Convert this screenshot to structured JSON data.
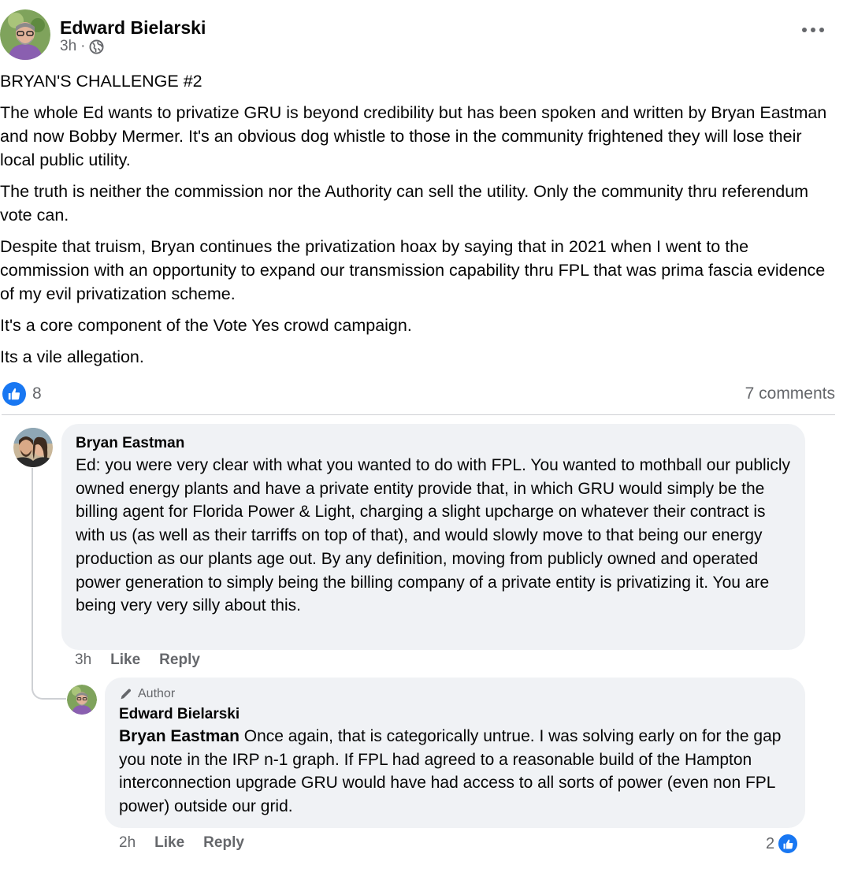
{
  "post": {
    "author": "Edward Bielarski",
    "time": "3h",
    "separator": "·",
    "privacy_icon": "globe-icon",
    "more_icon": "more-options-icon",
    "paragraphs": [
      "BRYAN'S CHALLENGE #2",
      "The whole Ed wants to privatize GRU is beyond credibility but has been spoken and written by Bryan Eastman and now Bobby Mermer.  It's an obvious dog whistle to those in the community frightened they will lose their local public utility.",
      "The truth is neither the commission nor the Authority can sell the utility.  Only the community thru referendum vote can.",
      "Despite that truism, Bryan continues the privatization hoax by saying that in 2021 when I went to the commission with an opportunity to expand our transmission capability thru FPL that was prima fascia evidence of my evil privatization scheme.",
      "It's a core component of the Vote Yes crowd campaign.",
      "Its a vile allegation."
    ],
    "like_count": "8",
    "comments_count": "7 comments"
  },
  "comments": [
    {
      "author": "Bryan Eastman",
      "text": "Ed: you were very clear with what you wanted to do with FPL. You wanted to mothball our publicly owned energy plants and have a private entity provide that, in which GRU would simply be the billing agent for Florida Power & Light, charging a slight upcharge on whatever their contract is with us (as well as their tarriffs on top of that), and would slowly move to that being our energy production as our plants age out. By any definition, moving from publicly owned and operated power generation to simply being the billing company of a private entity is privatizing it. You are being very very silly about this.",
      "time": "3h",
      "like_label": "Like",
      "reply_label": "Reply"
    },
    {
      "badge": "Author",
      "author": "Edward Bielarski",
      "mention": "Bryan Eastman",
      "text": " Once again, that is categorically untrue. I was solving early on for the gap you note in the IRP n-1 graph. If FPL had agreed to a reasonable build of the Hampton interconnection upgrade GRU would have had access to all sorts of power (even non FPL power) outside our grid.",
      "time": "2h",
      "like_label": "Like",
      "reply_label": "Reply",
      "reaction_count": "2"
    }
  ],
  "colors": {
    "accent": "#1877f2",
    "secondary_text": "#65676b",
    "bubble": "#f0f2f5"
  }
}
